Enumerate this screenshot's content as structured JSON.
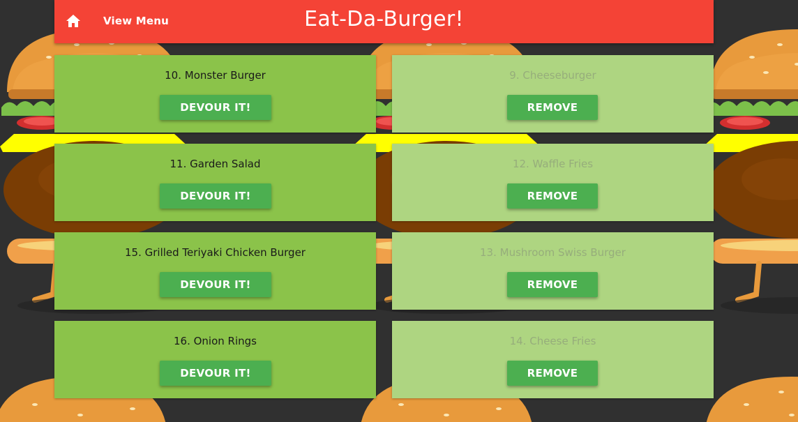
{
  "navbar": {
    "home_icon": "home-icon",
    "view_menu_label": "View Menu",
    "brand": "Eat-Da-Burger!",
    "color": "#f44336"
  },
  "colors": {
    "todo_card": "#8bc34a",
    "devoured_card": "#aed581",
    "button": "#4caf50",
    "background": "#303030"
  },
  "todo_items": [
    {
      "name": "10. Monster Burger",
      "button": "DEVOUR IT!"
    },
    {
      "name": "11. Garden Salad",
      "button": "DEVOUR IT!"
    },
    {
      "name": "15. Grilled Teriyaki Chicken Burger",
      "button": "DEVOUR IT!"
    },
    {
      "name": "16. Onion Rings",
      "button": "DEVOUR IT!"
    }
  ],
  "devoured_items": [
    {
      "name": "9. Cheeseburger",
      "button": "REMOVE"
    },
    {
      "name": "12. Waffle Fries",
      "button": "REMOVE"
    },
    {
      "name": "13. Mushroom Swiss Burger",
      "button": "REMOVE"
    },
    {
      "name": "14. Cheese Fries",
      "button": "REMOVE"
    }
  ]
}
